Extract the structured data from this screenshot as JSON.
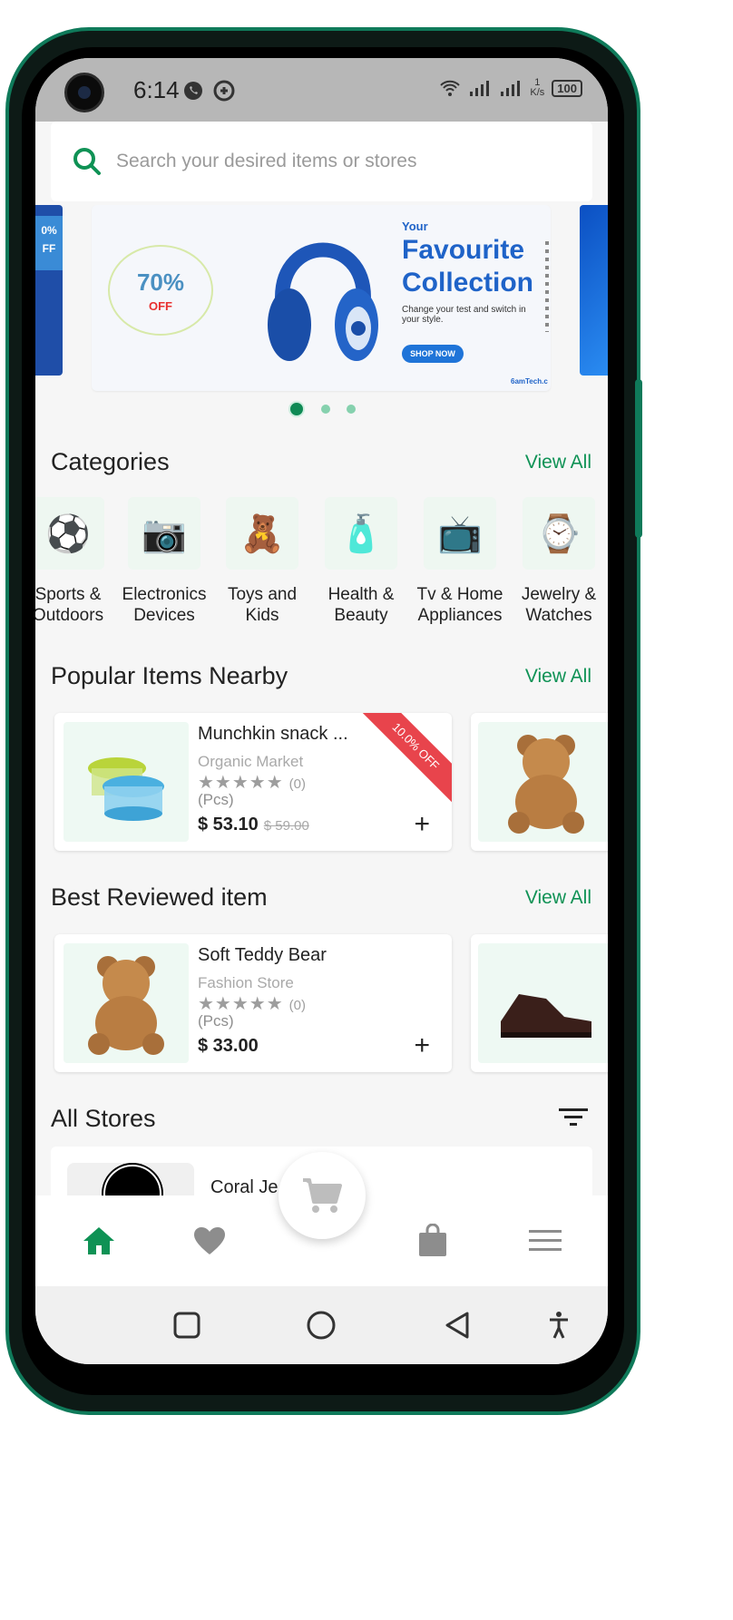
{
  "status": {
    "time": "6:14",
    "network_speed": "1\nK/s",
    "battery": "100"
  },
  "search": {
    "placeholder": "Search your desired items or stores"
  },
  "banner": {
    "discount_value": "70%",
    "discount_label": "OFF",
    "kicker": "Your",
    "headline_line1": "Favourite",
    "headline_line2": "Collection",
    "subtitle": "Change your test and switch in your style.",
    "cta": "SHOP NOW",
    "brand": "6amTech.c",
    "left_peek_pct": "0%",
    "left_peek_off": "FF"
  },
  "categories": {
    "title": "Categories",
    "view_all": "View All",
    "items": [
      {
        "label": "Sports &\nOutdoors",
        "icon": "sports-icon"
      },
      {
        "label": "Electronics\nDevices",
        "icon": "electronics-icon"
      },
      {
        "label": "Toys and\nKids",
        "icon": "toys-icon"
      },
      {
        "label": "Health &\nBeauty",
        "icon": "health-icon"
      },
      {
        "label": "Tv & Home\nAppliances",
        "icon": "tv-icon"
      },
      {
        "label": "Jewelry &\nWatches",
        "icon": "jewelry-icon"
      }
    ]
  },
  "popular": {
    "title": "Popular Items Nearby",
    "view_all": "View All",
    "item": {
      "name": "Munchkin snack ...",
      "store": "Organic Market",
      "rating_count": "(0)",
      "unit": "(Pcs)",
      "price": "$ 53.10",
      "old_price": "$ 59.00",
      "discount": "10.0% OFF"
    }
  },
  "best_reviewed": {
    "title": "Best Reviewed item",
    "view_all": "View All",
    "item": {
      "name": "Soft Teddy Bear",
      "store": "Fashion Store",
      "rating_count": "(0)",
      "unit": "(Pcs)",
      "price": "$ 33.00"
    }
  },
  "stores": {
    "title": "All Stores",
    "first_store": "Coral Je"
  },
  "colors": {
    "accent": "#0f9255",
    "frame": "#0f7a5a",
    "ribbon": "#e8444c",
    "banner_blue": "#1f63c8"
  }
}
